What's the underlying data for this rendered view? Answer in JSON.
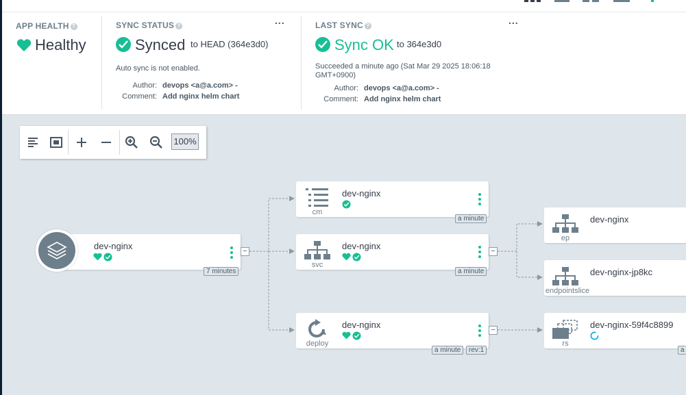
{
  "colors": {
    "brand_green": "#18be94",
    "text": "#363c4a",
    "muted": "#6d7f8b",
    "canvas": "#dee6eb"
  },
  "status": {
    "app_health": {
      "title": "APP HEALTH",
      "value": "Healthy",
      "icon": "heart-icon"
    },
    "sync_status": {
      "title": "SYNC STATUS",
      "value": "Synced",
      "target": "to HEAD (364e3d0)",
      "auto_sync": "Auto sync is not enabled.",
      "author_label": "Author:",
      "author_value": "devops <a@a.com> -",
      "comment_label": "Comment:",
      "comment_value": "Add nginx helm chart",
      "menu": "..."
    },
    "last_sync": {
      "title": "LAST SYNC",
      "value": "Sync OK",
      "target": "to 364e3d0",
      "succeeded_line1": "Succeeded a minute ago (Sat Mar 29 2025 18:06:18",
      "succeeded_line2": "GMT+0900)",
      "author_label": "Author:",
      "author_value": "devops <a@a.com> -",
      "comment_label": "Comment:",
      "comment_value": "Add nginx helm chart",
      "menu": "..."
    }
  },
  "toolbar": {
    "buttons": [
      "align-left-icon",
      "fit-screen-icon",
      "plus-icon",
      "minus-icon",
      "zoom-in-icon",
      "zoom-out-icon"
    ],
    "zoom": "100%"
  },
  "graph": {
    "app": {
      "name": "dev-nginx",
      "age": "7 minutes"
    },
    "cm": {
      "name": "dev-nginx",
      "kind": "cm",
      "age": "a minute"
    },
    "svc": {
      "name": "dev-nginx",
      "kind": "svc",
      "age": "a minute"
    },
    "deploy": {
      "name": "dev-nginx",
      "kind": "deploy",
      "age": "a minute",
      "rev": "rev:1"
    },
    "ep": {
      "name": "dev-nginx",
      "kind": "ep"
    },
    "endpointslice": {
      "name": "dev-nginx-jp8kc",
      "kind": "endpointslice"
    },
    "rs": {
      "name": "dev-nginx-59f4c8899",
      "kind": "rs"
    }
  }
}
